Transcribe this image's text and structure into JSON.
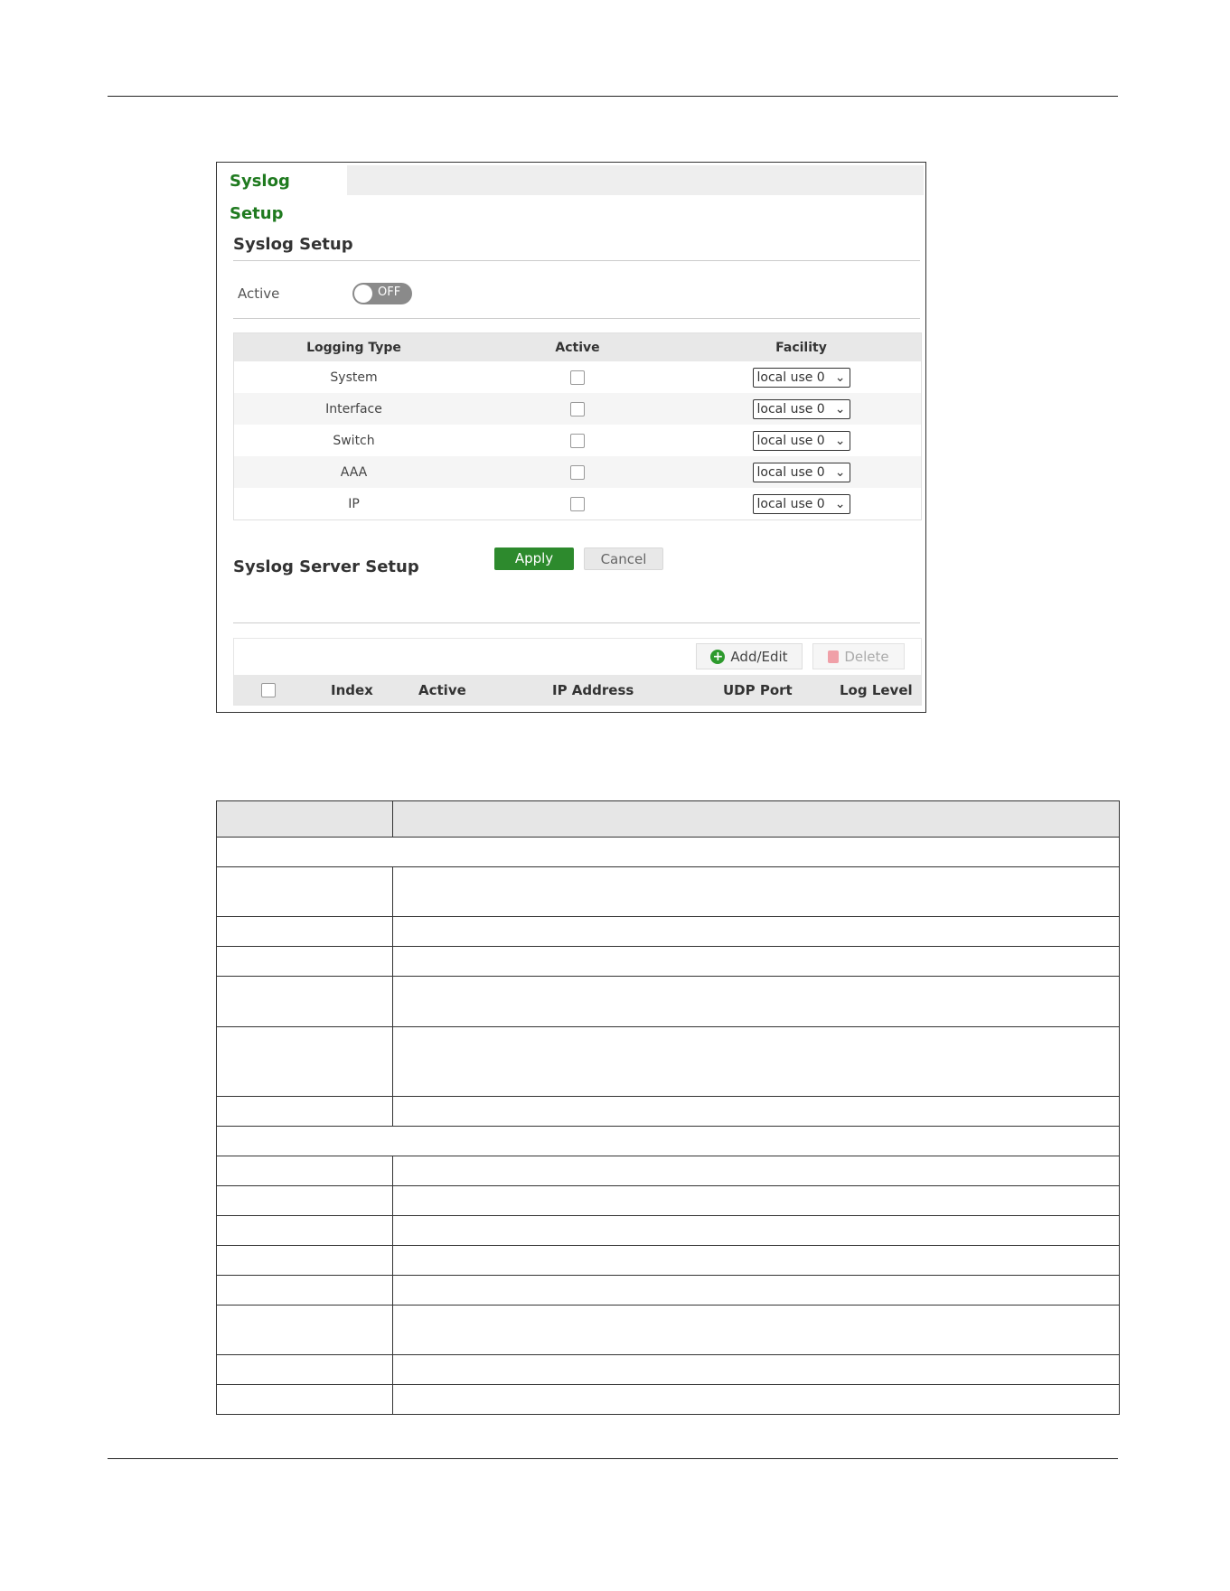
{
  "tab": {
    "label": "Syslog Setup"
  },
  "syslog_setup": {
    "title": "Syslog Setup",
    "active_label": "Active",
    "toggle_state": "OFF",
    "columns": [
      "Logging Type",
      "Active",
      "Facility"
    ],
    "rows": [
      {
        "type": "System",
        "active": false,
        "facility": "local use 0"
      },
      {
        "type": "Interface",
        "active": false,
        "facility": "local use 0"
      },
      {
        "type": "Switch",
        "active": false,
        "facility": "local use 0"
      },
      {
        "type": "AAA",
        "active": false,
        "facility": "local use 0"
      },
      {
        "type": "IP",
        "active": false,
        "facility": "local use 0"
      }
    ],
    "apply_label": "Apply",
    "cancel_label": "Cancel"
  },
  "server_setup": {
    "title": "Syslog Server Setup",
    "add_edit_label": "Add/Edit",
    "delete_label": "Delete",
    "columns": [
      "Index",
      "Active",
      "IP Address",
      "UDP Port",
      "Log Level"
    ]
  },
  "colors": {
    "accent": "#2d8a2d",
    "tab_text": "#1f7a1f",
    "toggle_off": "#8a8a8a"
  }
}
